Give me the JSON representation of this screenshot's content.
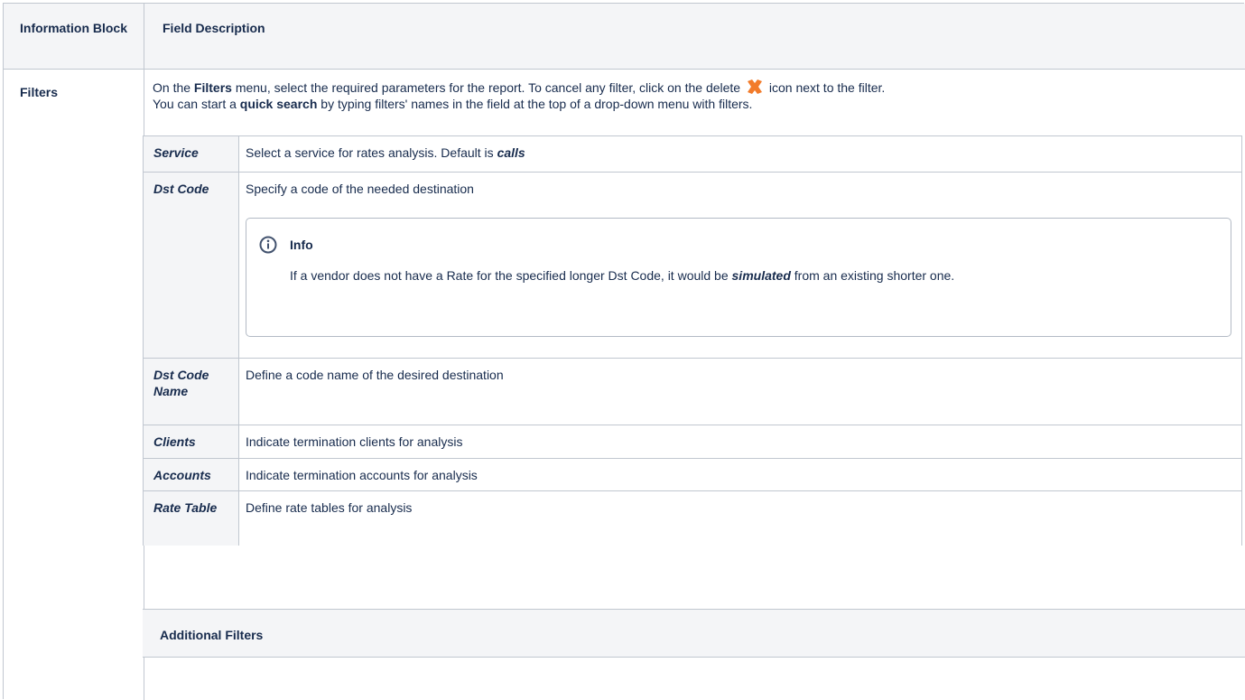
{
  "header": {
    "col1": "Information Block",
    "col2": "Field Description"
  },
  "filters": {
    "label": "Filters",
    "desc": {
      "p1": "On the ",
      "filters_word": "Filters",
      "p2": " menu, select the required parameters for the report. To cancel any filter, click on the delete ",
      "p3": " icon next to the filter.",
      "p4": "You can start a ",
      "quick_search": "quick search",
      "p5": " by typing filters' names in the field at the top of a drop-down menu with filters."
    },
    "icon": "delete-icon",
    "rows": [
      {
        "label": "Service",
        "text": "Select a service for rates analysis. Default is ",
        "emph": "calls"
      },
      {
        "label": "Dst Code",
        "text": "Specify a code of the needed destination",
        "info": {
          "icon": "info-icon",
          "title": "Info",
          "body_a": "If a vendor does not have a Rate for the specified longer Dst Code, it would be ",
          "body_emph": "simulated",
          "body_b": " from an existing shorter one."
        }
      },
      {
        "label": "Dst Code Name",
        "text": "Define a code name of the desired destination"
      },
      {
        "label": "Clients",
        "text": "Indicate termination clients for analysis"
      },
      {
        "label": "Accounts",
        "text": "Indicate termination accounts for analysis"
      },
      {
        "label": "Rate Table",
        "text": "Define rate tables for analysis"
      }
    ],
    "additional": "Additional Filters"
  },
  "colors": {
    "border": "#c1c7d0",
    "header_bg": "#f4f5f7",
    "text": "#172b4d",
    "delete_icon": "#f27b2a",
    "info_icon": "#42526e"
  }
}
